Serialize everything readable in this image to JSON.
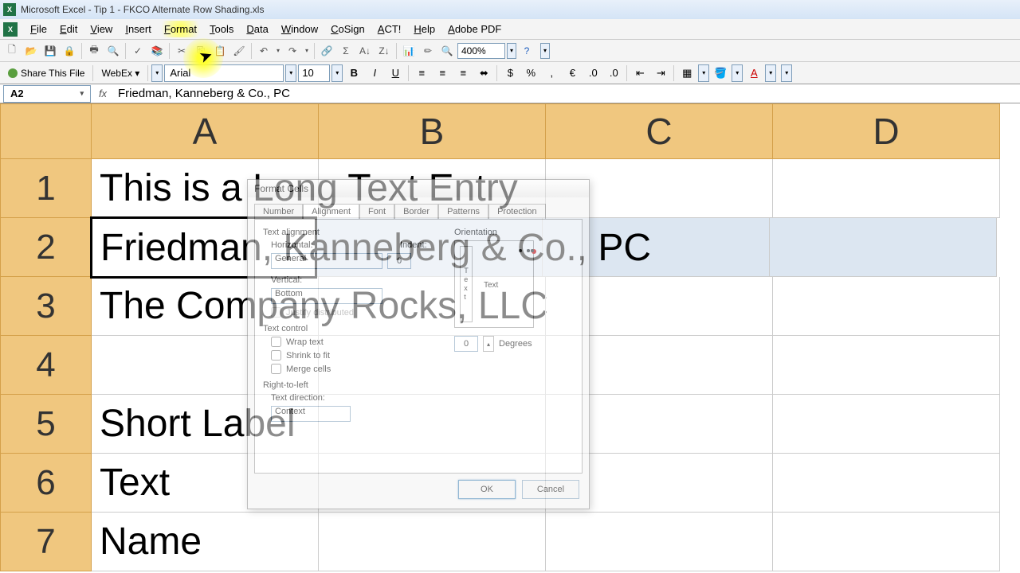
{
  "titlebar": {
    "title": "Microsoft Excel - Tip 1 - FKCO Alternate Row Shading.xls"
  },
  "menu": {
    "items": [
      "File",
      "Edit",
      "View",
      "Insert",
      "Format",
      "Tools",
      "Data",
      "Window",
      "CoSign",
      "ACT!",
      "Help",
      "Adobe PDF"
    ]
  },
  "toolbar2_share": {
    "label": "Share This File",
    "webex": "WebEx ▾"
  },
  "font": {
    "name": "Arial",
    "size": "10"
  },
  "zoom": {
    "value": "400%"
  },
  "namebox": {
    "ref": "A2"
  },
  "formula": {
    "value": "Friedman, Kanneberg & Co., PC"
  },
  "columns": [
    "A",
    "B",
    "C",
    "D"
  ],
  "rows": [
    {
      "num": "1",
      "a": "This is a Long Text Entry"
    },
    {
      "num": "2",
      "a": "Friedman, Kanneberg & Co., PC"
    },
    {
      "num": "3",
      "a": "The Company Rocks, LLC"
    },
    {
      "num": "4",
      "a": ""
    },
    {
      "num": "5",
      "a": "Short Label"
    },
    {
      "num": "6",
      "a": "Text"
    },
    {
      "num": "7",
      "a": "Name"
    }
  ],
  "dialog": {
    "title": "Format Cells",
    "tabs": [
      "Number",
      "Alignment",
      "Font",
      "Border",
      "Patterns",
      "Protection"
    ],
    "active_tab": "Alignment",
    "text_alignment_label": "Text alignment",
    "horizontal_label": "Horizontal:",
    "horizontal_value": "General",
    "indent_label": "Indent:",
    "indent_value": "0",
    "vertical_label": "Vertical:",
    "vertical_value": "Bottom",
    "justify_label": "Justify distributed",
    "text_control_label": "Text control",
    "wrap_label": "Wrap text",
    "shrink_label": "Shrink to fit",
    "merge_label": "Merge cells",
    "rtl_label": "Right-to-left",
    "textdir_label": "Text direction:",
    "textdir_value": "Context",
    "orientation_label": "Orientation",
    "orient_text": "Text",
    "degrees_value": "0",
    "degrees_label": "Degrees",
    "ok": "OK",
    "cancel": "Cancel"
  }
}
